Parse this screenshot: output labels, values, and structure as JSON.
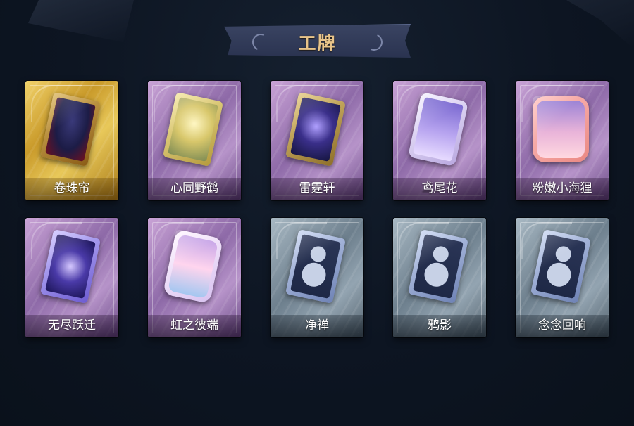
{
  "header": {
    "title": "工牌"
  },
  "cards": [
    {
      "label": "卷珠帘",
      "rarity": "gold",
      "badge_icon": "juanzhulian-badge-icon"
    },
    {
      "label": "心同野鹤",
      "rarity": "purple",
      "badge_icon": "xintongyehe-badge-icon"
    },
    {
      "label": "雷霆轩",
      "rarity": "purple",
      "badge_icon": "leitingxuan-badge-icon"
    },
    {
      "label": "鸢尾花",
      "rarity": "purple",
      "badge_icon": "yuanweihua-badge-icon"
    },
    {
      "label": "粉嫩小海狸",
      "rarity": "purple",
      "badge_icon": "fennenxiaohaili-badge-icon"
    },
    {
      "label": "无尽跃迁",
      "rarity": "purple",
      "badge_icon": "wujinyueqian-badge-icon"
    },
    {
      "label": "虹之彼端",
      "rarity": "purple",
      "badge_icon": "hongzhibiduan-badge-icon"
    },
    {
      "label": "净禅",
      "rarity": "grey",
      "badge_icon": "silhouette-badge-icon"
    },
    {
      "label": "鸦影",
      "rarity": "grey",
      "badge_icon": "silhouette-badge-icon"
    },
    {
      "label": "念念回响",
      "rarity": "grey",
      "badge_icon": "silhouette-badge-icon"
    }
  ],
  "colors": {
    "background": "#0c1420",
    "title_gold": "#e8c48a",
    "gold_frame": "#d4a83a",
    "purple_frame": "#a47fbd",
    "grey_frame": "#7f909d"
  }
}
